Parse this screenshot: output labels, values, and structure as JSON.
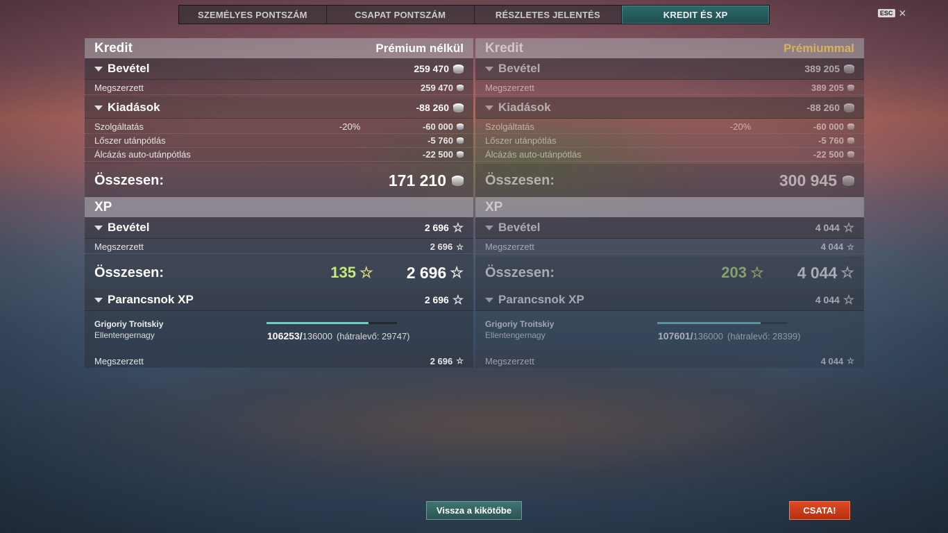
{
  "tabs": [
    {
      "label": "SZEMÉLYES PONTSZÁM",
      "active": false
    },
    {
      "label": "CSAPAT PONTSZÁM",
      "active": false
    },
    {
      "label": "RÉSZLETES JELENTÉS",
      "active": false
    },
    {
      "label": "KREDIT ÉS XP",
      "active": true
    }
  ],
  "esc_label": "ESC",
  "credit_label": "Kredit",
  "xp_label": "XP",
  "income_label": "Bevétel",
  "expenses_label": "Kiadások",
  "earned_label": "Megszerzett",
  "total_label": "Összesen:",
  "commander_label": "Parancsnok XP",
  "service_label": "Szolgáltatás",
  "ammo_label": "Lőszer utánpótlás",
  "camo_label": "Álcázás auto-utánpótlás",
  "left": {
    "mode": "Prémium nélkül",
    "credit_income": "259 470",
    "credit_earned": "259 470",
    "expenses": "-88 260",
    "service_pct": "-20%",
    "service": "-60 000",
    "ammo": "-5 760",
    "camo": "-22 500",
    "credit_total": "171 210",
    "xp_income": "2 696",
    "xp_earned": "2 696",
    "xp_bonus": "135",
    "xp_total": "2 696",
    "cmd_xp": "2 696",
    "cmd_name": "Grigoriy Troitskiy",
    "cmd_rank": "Ellentengernagy",
    "cmd_current": "106253/",
    "cmd_max": "136000",
    "cmd_remaining": "(hátralevő: 29747)",
    "cmd_progress": 0.781,
    "cmd_earned": "2 696"
  },
  "right": {
    "mode": "Prémiummal",
    "credit_income": "389 205",
    "credit_earned": "389 205",
    "expenses": "-88 260",
    "service_pct": "-20%",
    "service": "-60 000",
    "ammo": "-5 760",
    "camo": "-22 500",
    "credit_total": "300 945",
    "xp_income": "4 044",
    "xp_earned": "4 044",
    "xp_bonus": "203",
    "xp_total": "4 044",
    "cmd_xp": "4 044",
    "cmd_name": "Grigoriy Troitskiy",
    "cmd_rank": "Ellentengernagy",
    "cmd_current": "107601/",
    "cmd_max": "136000",
    "cmd_remaining": "(hátralevő: 28399)",
    "cmd_progress": 0.791,
    "cmd_earned": "4 044"
  },
  "back_button": "Vissza a kikötőbe",
  "battle_button": "CSATA!",
  "colors": {
    "active_tab": "#2d6a6a",
    "premium_gold": "#d8b25a",
    "bonus_green": "#c8e87a",
    "progress": "#6fd0c8",
    "battle_red": "#d03c1a"
  }
}
